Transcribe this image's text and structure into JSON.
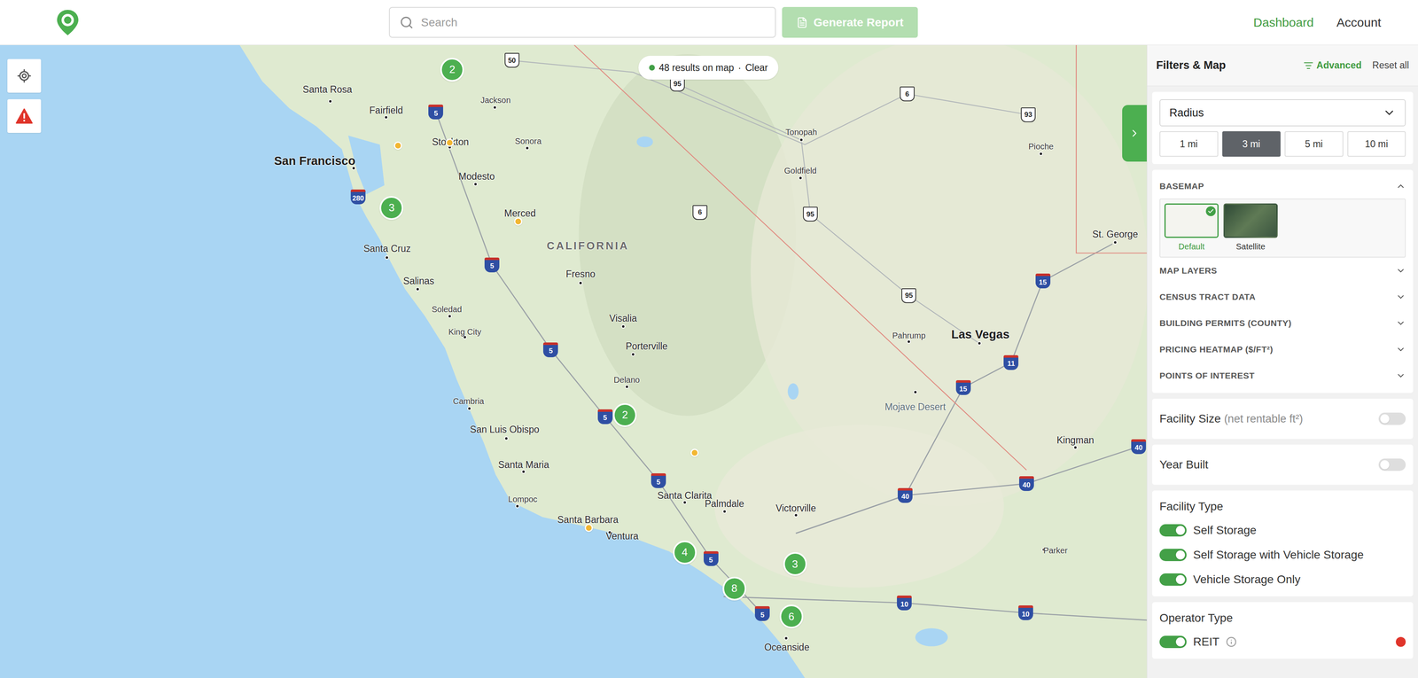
{
  "header": {
    "search": {
      "placeholder": "Search"
    },
    "generate_button": {
      "label": "Generate Report",
      "disabled": true
    },
    "nav": [
      {
        "label": "Dashboard",
        "selected": true
      },
      {
        "label": "Account",
        "selected": false
      }
    ]
  },
  "map": {
    "results": {
      "count_text": "48 results on map",
      "separator": "·",
      "clear": "Clear"
    },
    "labels": [
      {
        "text": "Santa Rosa",
        "kind": "city"
      },
      {
        "text": "Fairfield",
        "kind": "city"
      },
      {
        "text": "Stockton",
        "kind": "city"
      },
      {
        "text": "Jackson",
        "kind": "small"
      },
      {
        "text": "Sonora",
        "kind": "small"
      },
      {
        "text": "Modesto",
        "kind": "city"
      },
      {
        "text": "Merced",
        "kind": "city"
      },
      {
        "text": "San Francisco",
        "kind": "major"
      },
      {
        "text": "CALIFORNIA",
        "kind": "region"
      },
      {
        "text": "Fresno",
        "kind": "city"
      },
      {
        "text": "Santa Cruz",
        "kind": "city"
      },
      {
        "text": "Salinas",
        "kind": "city"
      },
      {
        "text": "Soledad",
        "kind": "small"
      },
      {
        "text": "King City",
        "kind": "small"
      },
      {
        "text": "Visalia",
        "kind": "city"
      },
      {
        "text": "Porterville",
        "kind": "city"
      },
      {
        "text": "Delano",
        "kind": "small"
      },
      {
        "text": "Cambria",
        "kind": "small"
      },
      {
        "text": "San Luis Obispo",
        "kind": "city"
      },
      {
        "text": "Santa Maria",
        "kind": "city"
      },
      {
        "text": "Lompoc",
        "kind": "small"
      },
      {
        "text": "Santa Barbara",
        "kind": "city"
      },
      {
        "text": "Ventura",
        "kind": "city"
      },
      {
        "text": "Santa Clarita",
        "kind": "city"
      },
      {
        "text": "Palmdale",
        "kind": "city"
      },
      {
        "text": "Victorville",
        "kind": "city"
      },
      {
        "text": "Oceanside",
        "kind": "city"
      },
      {
        "text": "Tonopah",
        "kind": "small"
      },
      {
        "text": "Goldfield",
        "kind": "small"
      },
      {
        "text": "Pioche",
        "kind": "small"
      },
      {
        "text": "St. George",
        "kind": "city"
      },
      {
        "text": "Las Vegas",
        "kind": "major"
      },
      {
        "text": "Pahrump",
        "kind": "small"
      },
      {
        "text": "Mojave Desert",
        "kind": "area"
      },
      {
        "text": "Kingman",
        "kind": "city"
      },
      {
        "text": "Parker",
        "kind": "small"
      }
    ],
    "shields": [
      {
        "text": "5",
        "kind": "interstate"
      },
      {
        "text": "280",
        "kind": "interstate"
      },
      {
        "text": "5",
        "kind": "interstate"
      },
      {
        "text": "5",
        "kind": "interstate"
      },
      {
        "text": "5",
        "kind": "interstate"
      },
      {
        "text": "5",
        "kind": "interstate"
      },
      {
        "text": "5",
        "kind": "interstate"
      },
      {
        "text": "5",
        "kind": "interstate"
      },
      {
        "text": "10",
        "kind": "interstate"
      },
      {
        "text": "10",
        "kind": "interstate"
      },
      {
        "text": "15",
        "kind": "interstate"
      },
      {
        "text": "15",
        "kind": "interstate"
      },
      {
        "text": "40",
        "kind": "interstate"
      },
      {
        "text": "40",
        "kind": "interstate"
      },
      {
        "text": "40",
        "kind": "interstate"
      },
      {
        "text": "11",
        "kind": "interstate"
      },
      {
        "text": "50",
        "kind": "us"
      },
      {
        "text": "95",
        "kind": "us"
      },
      {
        "text": "6",
        "kind": "us"
      },
      {
        "text": "93",
        "kind": "us"
      },
      {
        "text": "6",
        "kind": "us"
      },
      {
        "text": "95",
        "kind": "us"
      },
      {
        "text": "95",
        "kind": "us"
      }
    ],
    "clusters": [
      {
        "count": "2"
      },
      {
        "count": "3"
      },
      {
        "count": "2"
      },
      {
        "count": "4"
      },
      {
        "count": "8"
      },
      {
        "count": "3"
      },
      {
        "count": "6"
      }
    ],
    "pins": [
      {
        "color": "#f2b632"
      },
      {
        "color": "#f2b632"
      },
      {
        "color": "#f2b632"
      },
      {
        "color": "#f2b632"
      },
      {
        "color": "#f2b632"
      }
    ]
  },
  "sidebar": {
    "title": "Filters & Map",
    "advanced": "Advanced",
    "reset": "Reset all",
    "radius": {
      "label": "Radius",
      "options": [
        {
          "label": "1 mi",
          "selected": false
        },
        {
          "label": "3 mi",
          "selected": true
        },
        {
          "label": "5 mi",
          "selected": false
        },
        {
          "label": "10 mi",
          "selected": false
        }
      ]
    },
    "basemap": {
      "label": "BASEMAP",
      "expanded": true,
      "options": [
        {
          "label": "Default",
          "selected": true
        },
        {
          "label": "Satellite",
          "selected": false
        }
      ]
    },
    "sections": [
      {
        "label": "MAP LAYERS",
        "expanded": false
      },
      {
        "label": "CENSUS TRACT DATA",
        "expanded": false
      },
      {
        "label": "BUILDING PERMITS (COUNTY)",
        "expanded": false
      },
      {
        "label": "PRICING HEATMAP ($/FT²)",
        "expanded": false
      },
      {
        "label": "POINTS OF INTEREST",
        "expanded": false
      }
    ],
    "range_filters": [
      {
        "label": "Facility Size",
        "sub": "(net rentable ft²)",
        "on": false
      },
      {
        "label": "Year Built",
        "sub": "",
        "on": false
      }
    ],
    "facility_type": {
      "title": "Facility Type",
      "items": [
        {
          "label": "Self Storage",
          "on": true
        },
        {
          "label": "Self Storage with Vehicle Storage",
          "on": true
        },
        {
          "label": "Vehicle Storage Only",
          "on": true
        }
      ]
    },
    "operator_type": {
      "title": "Operator Type",
      "items": [
        {
          "label": "REIT",
          "on": true
        }
      ]
    }
  }
}
